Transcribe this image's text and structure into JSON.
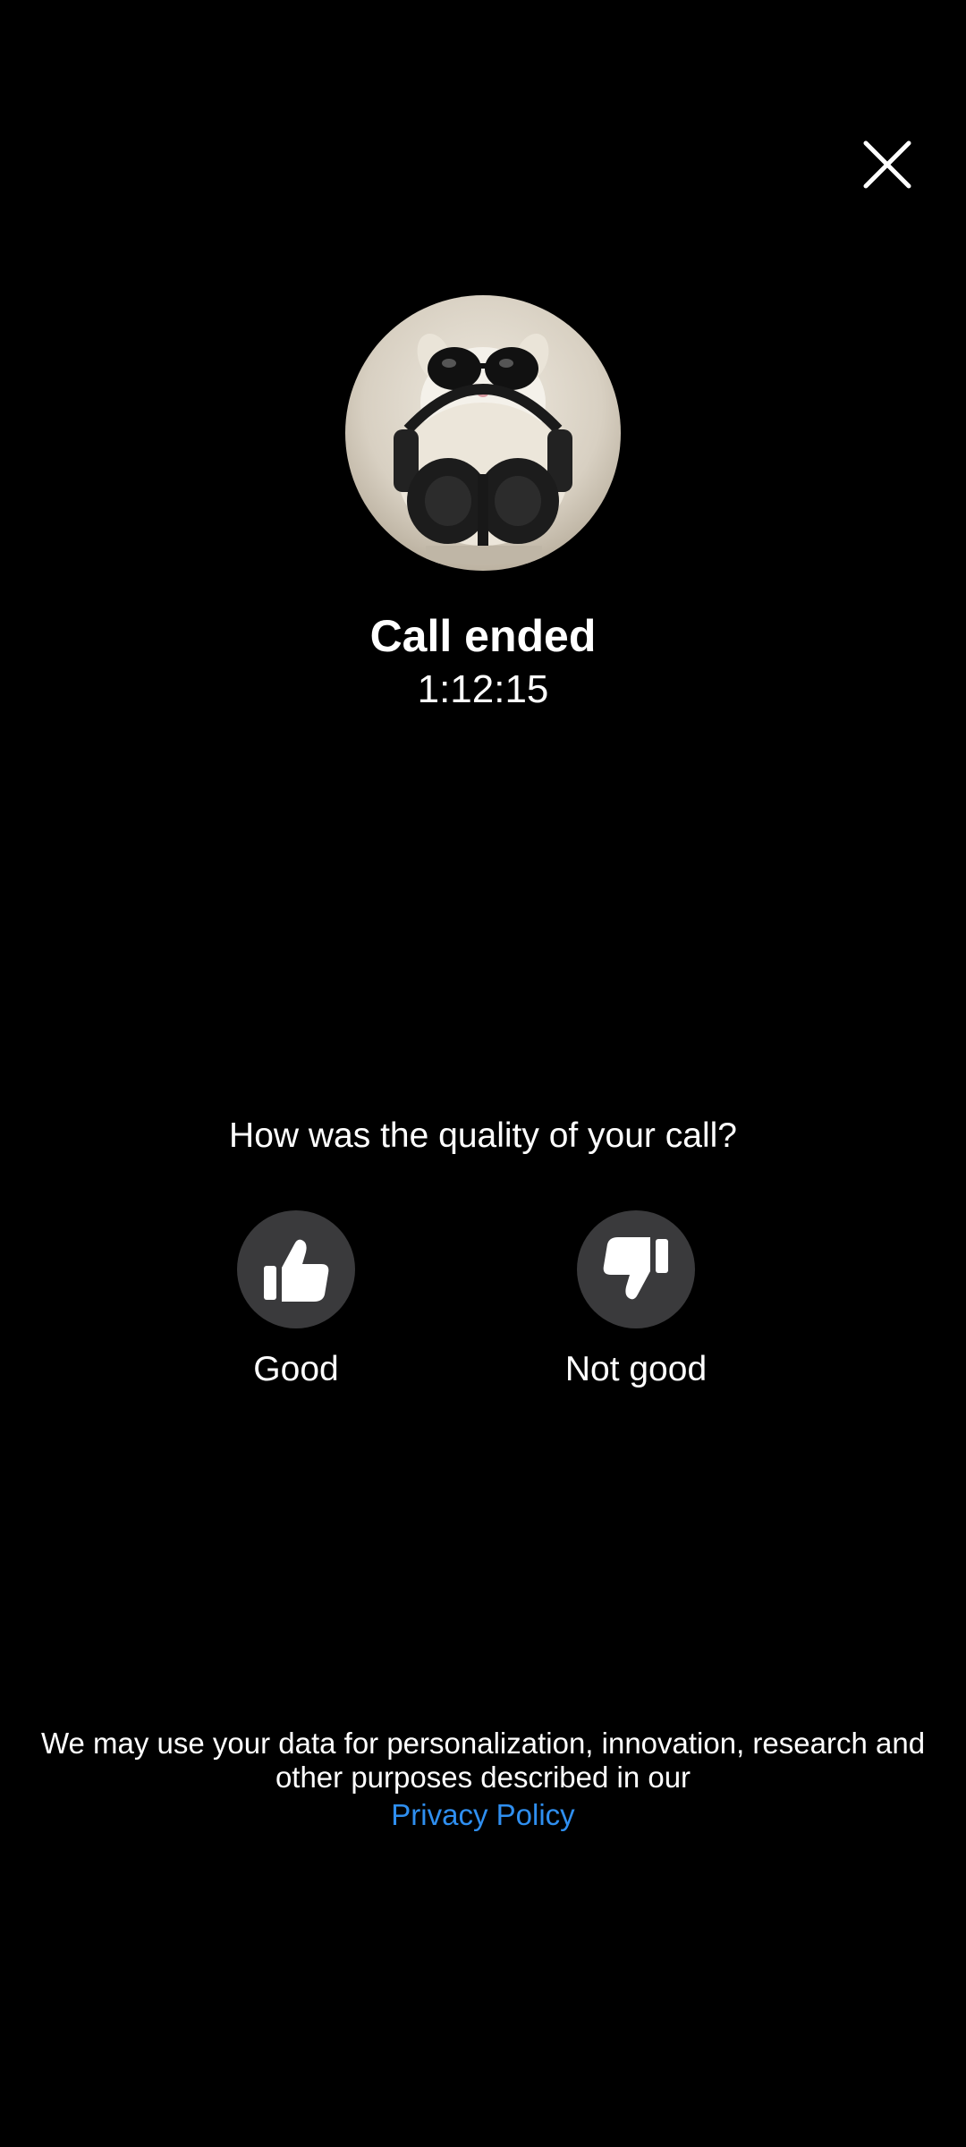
{
  "header": {
    "close_icon": "close-icon"
  },
  "caller": {
    "avatar": "profile-photo-cat-sunglasses-headphones"
  },
  "call": {
    "status": "Call ended",
    "duration": "1:12:15"
  },
  "feedback": {
    "question": "How was the quality of your call?",
    "good_label": "Good",
    "good_icon": "thumbs-up-icon",
    "bad_label": "Not good",
    "bad_icon": "thumbs-down-icon"
  },
  "footer": {
    "disclaimer": "We may use your data for personalization, innovation, research and other purposes described in our",
    "privacy_link": "Privacy Policy",
    "link_color": "#2f8ff0"
  },
  "colors": {
    "background": "#000000",
    "button_bg": "#3a3a3c",
    "text": "#ffffff"
  }
}
